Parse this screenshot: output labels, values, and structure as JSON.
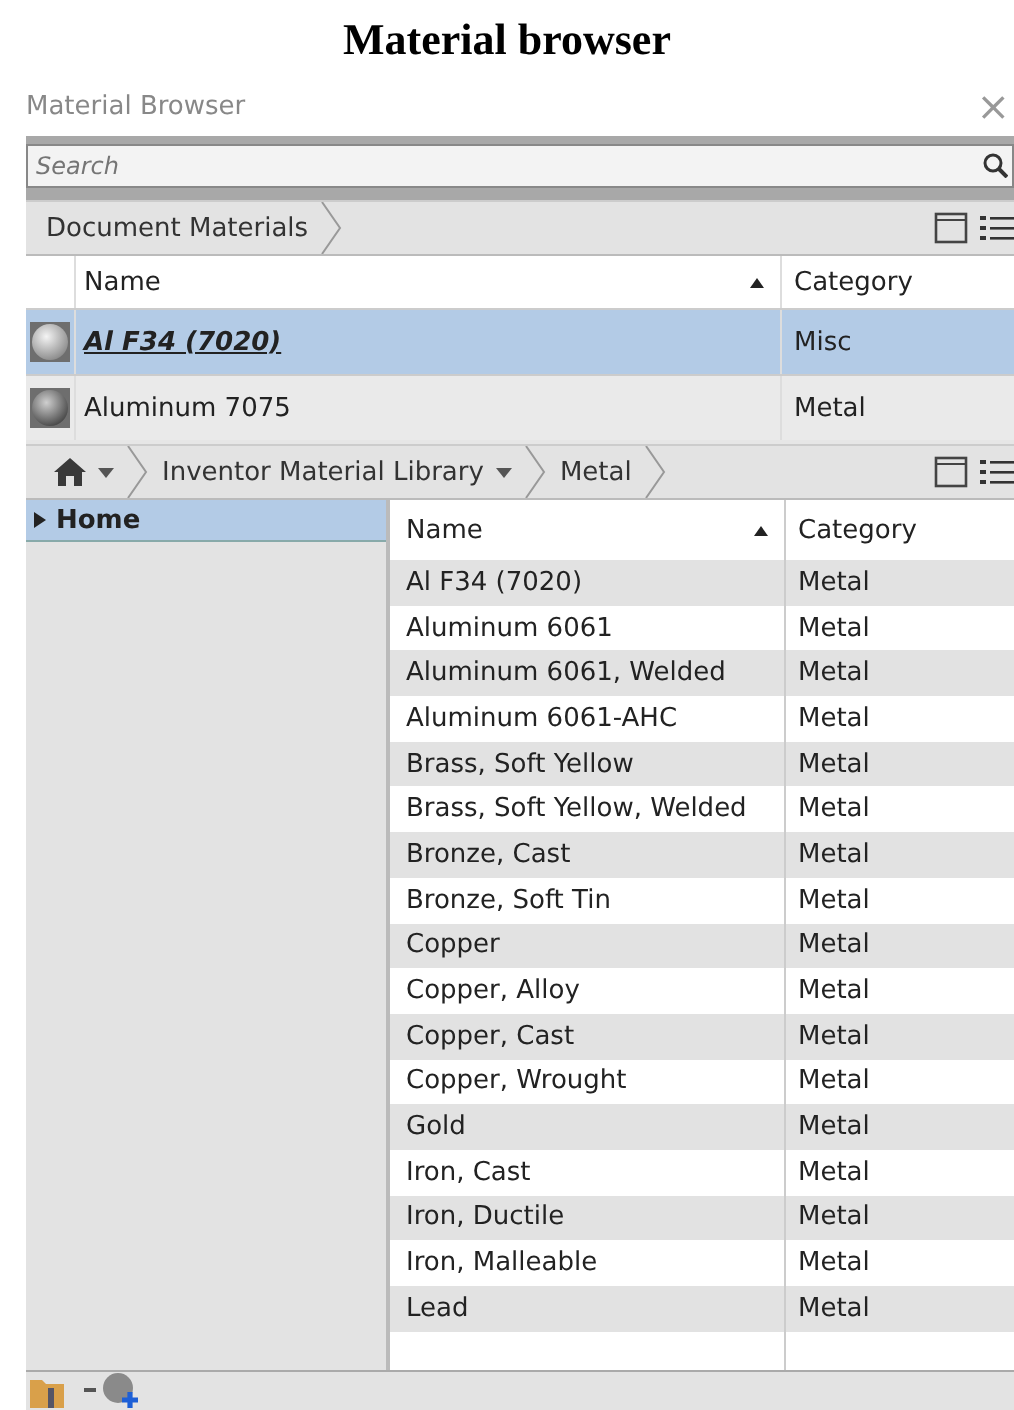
{
  "heading": "Material browser",
  "window": {
    "title": "Material Browser",
    "close": "×"
  },
  "search": {
    "placeholder": "Search"
  },
  "document_materials": {
    "breadcrumb": "Document Materials",
    "columns": [
      "Name",
      "Category"
    ],
    "rows": [
      {
        "name": "Al F34 (7020)",
        "category": "Misc",
        "selected": true
      },
      {
        "name": "Aluminum 7075",
        "category": "Metal",
        "selected": false
      }
    ]
  },
  "library": {
    "breadcrumb": [
      "Inventor Material Library",
      "Metal"
    ],
    "tree": [
      {
        "label": "Home",
        "selected": true,
        "expanded": false
      }
    ],
    "columns": [
      "Name",
      "Category"
    ],
    "rows": [
      {
        "name": "Al F34 (7020)",
        "category": "Metal"
      },
      {
        "name": "Aluminum 6061",
        "category": "Metal"
      },
      {
        "name": "Aluminum 6061, Welded",
        "category": "Metal"
      },
      {
        "name": "Aluminum 6061-AHC",
        "category": "Metal"
      },
      {
        "name": "Brass, Soft Yellow",
        "category": "Metal"
      },
      {
        "name": "Brass, Soft Yellow, Welded",
        "category": "Metal"
      },
      {
        "name": "Bronze, Cast",
        "category": "Metal"
      },
      {
        "name": "Bronze, Soft Tin",
        "category": "Metal"
      },
      {
        "name": "Copper",
        "category": "Metal"
      },
      {
        "name": "Copper, Alloy",
        "category": "Metal"
      },
      {
        "name": "Copper, Cast",
        "category": "Metal"
      },
      {
        "name": "Copper, Wrought",
        "category": "Metal"
      },
      {
        "name": "Gold",
        "category": "Metal"
      },
      {
        "name": "Iron, Cast",
        "category": "Metal"
      },
      {
        "name": "Iron, Ductile",
        "category": "Metal"
      },
      {
        "name": "Iron, Malleable",
        "category": "Metal"
      },
      {
        "name": "Lead",
        "category": "Metal"
      }
    ]
  }
}
